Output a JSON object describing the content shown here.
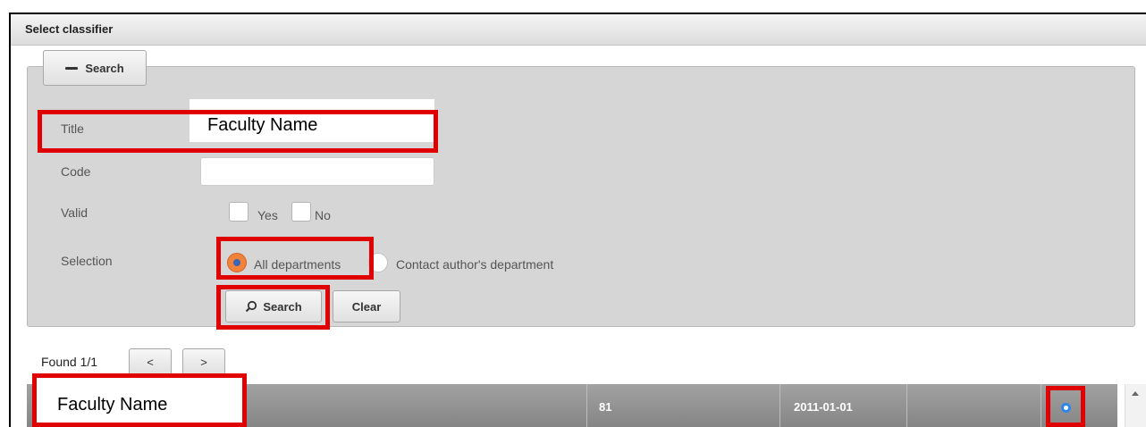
{
  "dialog": {
    "title": "Select classifier"
  },
  "search_panel": {
    "toggle_label": "Search",
    "fields": {
      "title_label": "Title",
      "title_value": "Faculty Name",
      "code_label": "Code",
      "code_value": "",
      "valid_label": "Valid",
      "valid_yes": "Yes",
      "valid_no": "No",
      "selection_label": "Selection",
      "selection_all": "All departments",
      "selection_contact": "Contact author's department",
      "selected_option": "All departments"
    },
    "search_button": "Search",
    "clear_button": "Clear"
  },
  "results": {
    "found_text": "Found 1/1",
    "prev_label": "<",
    "next_label": ">",
    "rows": [
      {
        "name": "Faculty Name",
        "code": "81",
        "date": "2011-01-01",
        "extra": ""
      }
    ]
  },
  "colors": {
    "highlight": "#e00000",
    "radio_selected": "#f0823a",
    "row_radio": "#2f86e8"
  }
}
